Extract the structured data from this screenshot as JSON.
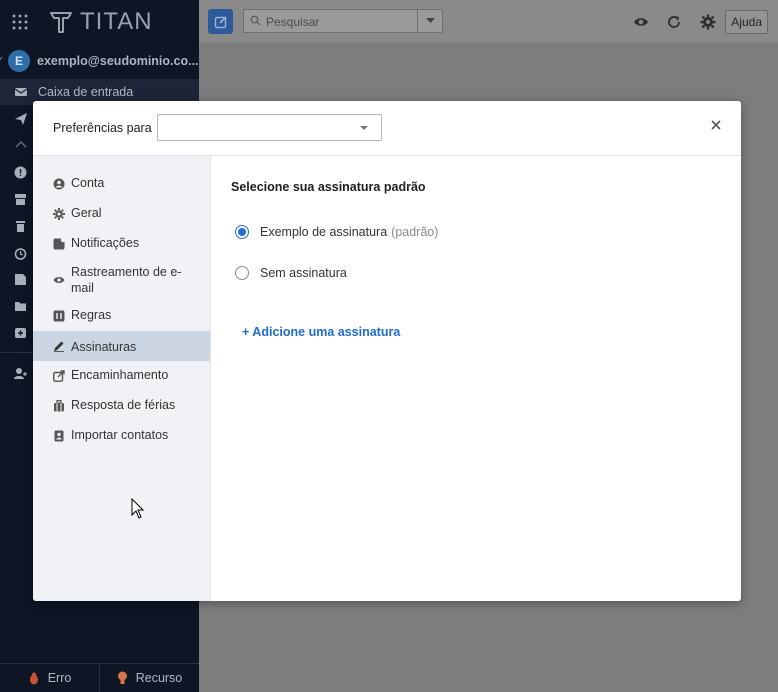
{
  "app": {
    "logo_text": "TITAN"
  },
  "account": {
    "avatar_letter": "E",
    "email": "exemplo@seudominio.co..."
  },
  "sidebar": {
    "inbox_label": "Caixa de entrada",
    "bottom": [
      {
        "label": "Erro",
        "icon": "bug-icon"
      },
      {
        "label": "Recurso",
        "icon": "lightbulb-icon"
      }
    ]
  },
  "topbar": {
    "search_placeholder": "Pesquisar",
    "help_label": "Ajuda"
  },
  "modal": {
    "pref_label": "Preferências para",
    "pref_value": "",
    "nav": [
      {
        "label": "Conta",
        "icon": "user-circle-icon"
      },
      {
        "label": "Geral",
        "icon": "gear-icon"
      },
      {
        "label": "Notificações",
        "icon": "notification-icon"
      },
      {
        "label": "Rastreamento de e-mail",
        "icon": "eye-icon"
      },
      {
        "label": "Regras",
        "icon": "rules-icon"
      },
      {
        "label": "Assinaturas",
        "icon": "pen-icon",
        "active": true
      },
      {
        "label": "Encaminhamento",
        "icon": "forward-icon"
      },
      {
        "label": "Resposta de férias",
        "icon": "suitcase-icon"
      },
      {
        "label": "Importar contatos",
        "icon": "contacts-icon"
      }
    ],
    "body": {
      "title": "Selecione sua assinatura padrão",
      "options": [
        {
          "label": "Exemplo de assinatura",
          "suffix": "(padrão)",
          "checked": true
        },
        {
          "label": "Sem assinatura",
          "suffix": "",
          "checked": false
        }
      ],
      "add_link": "+ Adicione uma assinatura"
    }
  },
  "colors": {
    "accent": "#2a6fd6",
    "link": "#1f6ccf",
    "sidebar_bg": "#0e1525",
    "nav_active": "#ccd5e2"
  }
}
